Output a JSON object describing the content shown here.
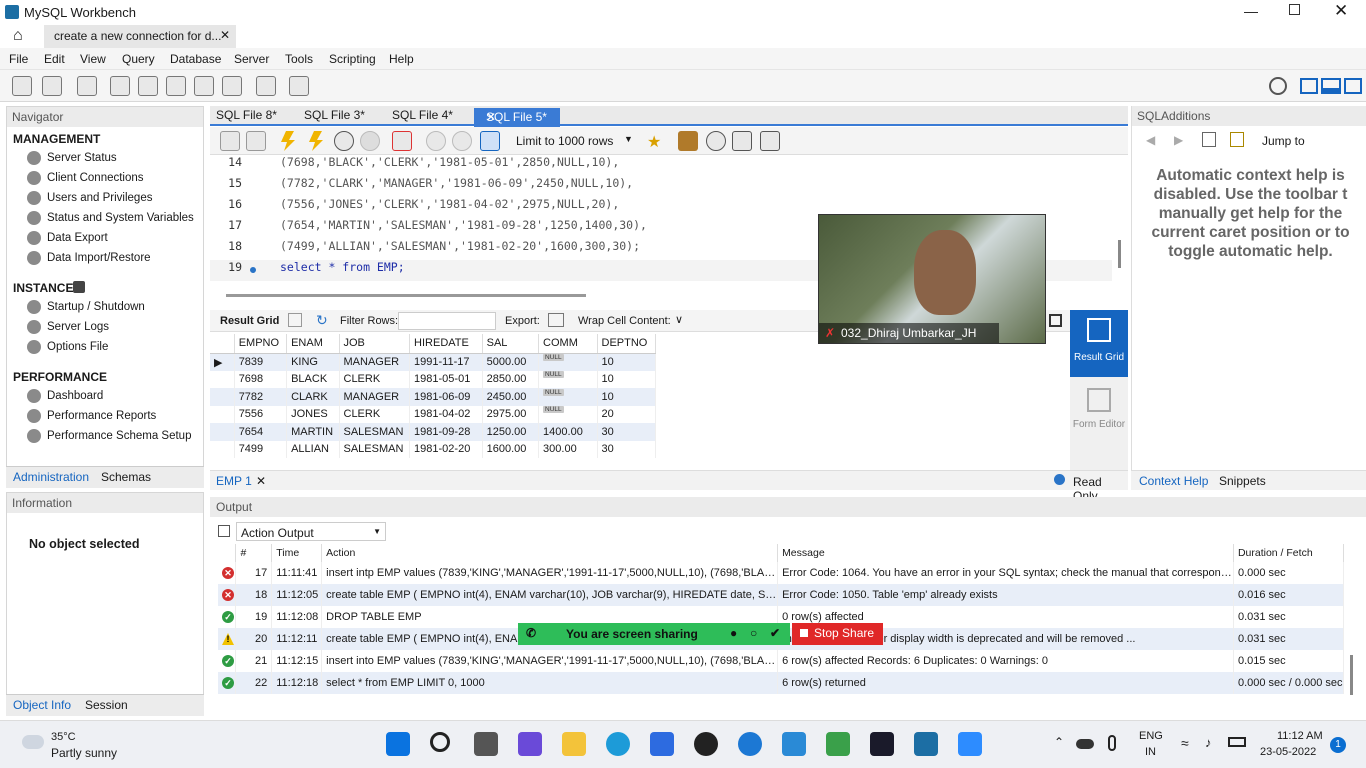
{
  "window": {
    "title": "MySQL Workbench",
    "connection_tab": "create a new connection for d..."
  },
  "menu": [
    "File",
    "Edit",
    "View",
    "Query",
    "Database",
    "Server",
    "Tools",
    "Scripting",
    "Help"
  ],
  "navigator": {
    "title": "Navigator",
    "management": {
      "title": "MANAGEMENT",
      "items": [
        "Server Status",
        "Client Connections",
        "Users and Privileges",
        "Status and System Variables",
        "Data Export",
        "Data Import/Restore"
      ]
    },
    "instance": {
      "title": "INSTANCE",
      "items": [
        "Startup / Shutdown",
        "Server Logs",
        "Options File"
      ]
    },
    "performance": {
      "title": "PERFORMANCE",
      "items": [
        "Dashboard",
        "Performance Reports",
        "Performance Schema Setup"
      ]
    },
    "tabs": [
      "Administration",
      "Schemas"
    ]
  },
  "information": {
    "title": "Information",
    "text": "No object selected",
    "tabs": [
      "Object Info",
      "Session"
    ]
  },
  "editor": {
    "tabs": [
      "SQL File 8*",
      "SQL File 3*",
      "SQL File 4*",
      "SQL File 5*"
    ],
    "limit": "Limit to 1000 rows",
    "lines": [
      {
        "n": "14",
        "code": "(7698,'BLACK','CLERK','1981-05-01',2850,NULL,10),"
      },
      {
        "n": "15",
        "code": "(7782,'CLARK','MANAGER','1981-06-09',2450,NULL,10),"
      },
      {
        "n": "16",
        "code": "(7556,'JONES','CLERK','1981-04-02',2975,NULL,20),"
      },
      {
        "n": "17",
        "code": "(7654,'MARTIN','SALESMAN','1981-09-28',1250,1400,30),"
      },
      {
        "n": "18",
        "code": "(7499,'ALLIAN','SALESMAN','1981-02-20',1600,300,30);"
      },
      {
        "n": "19",
        "code": "select * from EMP;"
      }
    ]
  },
  "result": {
    "toolbar": {
      "grid": "Result Grid",
      "filter": "Filter Rows:",
      "export": "Export:",
      "wrap": "Wrap Cell Content:"
    },
    "columns": [
      "EMPNO",
      "ENAM",
      "JOB",
      "HIREDATE",
      "SAL",
      "COMM",
      "DEPTNO"
    ],
    "rows": [
      [
        "7839",
        "KING",
        "MANAGER",
        "1991-11-17",
        "5000.00",
        "NULL",
        "10"
      ],
      [
        "7698",
        "BLACK",
        "CLERK",
        "1981-05-01",
        "2850.00",
        "NULL",
        "10"
      ],
      [
        "7782",
        "CLARK",
        "MANAGER",
        "1981-06-09",
        "2450.00",
        "NULL",
        "10"
      ],
      [
        "7556",
        "JONES",
        "CLERK",
        "1981-04-02",
        "2975.00",
        "NULL",
        "20"
      ],
      [
        "7654",
        "MARTIN",
        "SALESMAN",
        "1981-09-28",
        "1250.00",
        "1400.00",
        "30"
      ],
      [
        "7499",
        "ALLIAN",
        "SALESMAN",
        "1981-02-20",
        "1600.00",
        "300.00",
        "30"
      ]
    ],
    "side": {
      "grid": "Result Grid",
      "form": "Form Editor"
    },
    "tab": "EMP 1",
    "readonly": "Read Only"
  },
  "sqladditions": {
    "title": "SQLAdditions",
    "jump": "Jump to",
    "help": [
      "Automatic context help is",
      "disabled. Use the toolbar t",
      "manually get help for the",
      "current caret position or to",
      "toggle automatic help."
    ],
    "tabs": [
      "Context Help",
      "Snippets"
    ]
  },
  "output": {
    "title": "Output",
    "mode": "Action Output",
    "columns": [
      "#",
      "Time",
      "Action",
      "Message",
      "Duration / Fetch"
    ],
    "rows": [
      {
        "status": "err",
        "n": "17",
        "time": "11:11:41",
        "action": "insert intp EMP values (7839,'KING','MANAGER','1991-11-17',5000,NULL,10), (7698,'BLACK...",
        "message": "Error Code: 1064. You have an error in your SQL syntax; check the manual that corresponds ...",
        "dur": "0.000 sec"
      },
      {
        "status": "err",
        "n": "18",
        "time": "11:12:05",
        "action": "create table EMP ( EMPNO int(4), ENAM varchar(10), JOB varchar(9), HIREDATE date, SAL...",
        "message": "Error Code: 1050. Table 'emp' already exists",
        "dur": "0.016 sec"
      },
      {
        "status": "ok",
        "n": "19",
        "time": "11:12:08",
        "action": "DROP TABLE EMP",
        "message": "0 row(s) affected",
        "dur": "0.031 sec"
      },
      {
        "status": "warn",
        "n": "20",
        "time": "11:12:11",
        "action": "create table EMP ( EMPNO int(4), ENAM",
        "message": "rning(s): 1681 Integer display width is deprecated and will be removed ...",
        "dur": "0.031 sec"
      },
      {
        "status": "ok",
        "n": "21",
        "time": "11:12:15",
        "action": "insert into EMP values (7839,'KING','MANAGER','1991-11-17',5000,NULL,10), (7698,'BLACK...",
        "message": "6 row(s) affected Records: 6  Duplicates: 0  Warnings: 0",
        "dur": "0.015 sec"
      },
      {
        "status": "ok",
        "n": "22",
        "time": "11:12:18",
        "action": "select * from EMP LIMIT 0, 1000",
        "message": "6 row(s) returned",
        "dur": "0.000 sec / 0.000 sec"
      }
    ]
  },
  "video": {
    "name": "032_Dhiraj Umbarkar_JH"
  },
  "share": {
    "text": "You are screen sharing",
    "stop": "Stop Share"
  },
  "taskbar": {
    "temp": "35°C",
    "weather": "Partly sunny",
    "lang1": "ENG",
    "lang2": "IN",
    "time": "11:12 AM",
    "date": "23-05-2022",
    "badge": "1"
  },
  "colors": {
    "accent": "#3a7bd5",
    "result_grid": "#1565c0",
    "share_green": "#2ebd59",
    "share_red": "#e02828"
  }
}
